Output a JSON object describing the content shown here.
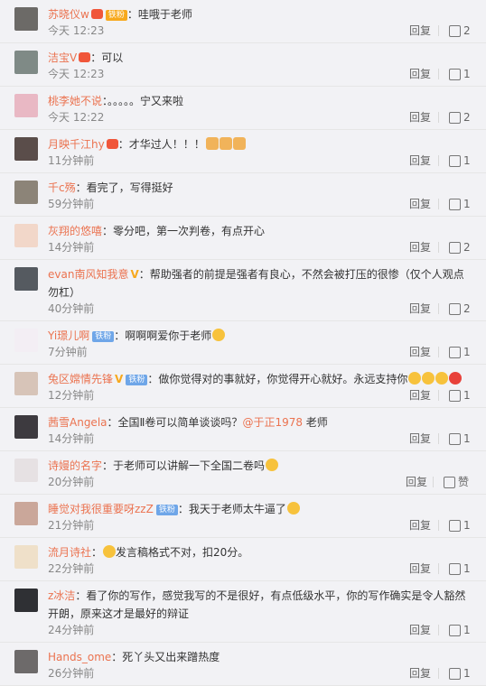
{
  "comments": [
    {
      "name": "苏晓仪w",
      "vip": true,
      "badge": "铁粉",
      "badge_color": "#f7a91e",
      "text": "：哇哦于老师",
      "time": "今天 12:23",
      "reply": "回复",
      "likes": "2",
      "avatar": "#6c6a67"
    },
    {
      "name": "洁宝V",
      "vip": true,
      "text": "：可以",
      "time": "今天 12:23",
      "reply": "回复",
      "likes": "1",
      "avatar": "#7f8a86"
    },
    {
      "name": "桃李她不说",
      "text": "：。。。。。宁又来啦",
      "time": "今天 12:22",
      "reply": "回复",
      "likes": "2",
      "avatar": "#e9b8c4"
    },
    {
      "name": "月映千江hy",
      "vip": true,
      "text": "：才华过人！！！",
      "emojis": [
        "thumb",
        "thumb",
        "thumb"
      ],
      "time": "11分钟前",
      "reply": "回复",
      "likes": "1",
      "avatar": "#5a4d4a"
    },
    {
      "name": "千c殇",
      "text": "：看完了，写得挺好",
      "time": "59分钟前",
      "reply": "回复",
      "likes": "1",
      "avatar": "#8c8478"
    },
    {
      "name": "灰翔的悠嘻",
      "text": "：零分吧，第一次判卷，有点开心",
      "time": "14分钟前",
      "reply": "回复",
      "likes": "2",
      "avatar": "#f2d7c9"
    },
    {
      "name": "evan南风知我意",
      "vgold": "V",
      "text": "：帮助强者的前提是强者有良心，不然会被打压的很惨（仅个人观点勿杠）",
      "time": "40分钟前",
      "reply": "回复",
      "likes": "2",
      "avatar": "#555a60",
      "tall": true
    },
    {
      "name": "Yi璟儿啊",
      "badge": "铁粉",
      "badge_color": "#6fa6e8",
      "text": "：啊啊啊爱你于老师",
      "emojis": [
        "face"
      ],
      "time": "7分钟前",
      "reply": "回复",
      "likes": "1",
      "avatar": "#f3eef4"
    },
    {
      "name": "兔区嫦情先锋",
      "vgold": "V",
      "badge": "铁粉",
      "badge_color": "#6fa6e8",
      "text": "：做你觉得对的事就好，你觉得开心就好。永远支持你",
      "emojis": [
        "face",
        "face",
        "face",
        "heart"
      ],
      "time": "12分钟前",
      "reply": "回复",
      "likes": "1",
      "avatar": "#d7c4b8"
    },
    {
      "name": "茜雪Angela",
      "text": "：全国Ⅱ卷可以简单谈谈吗？",
      "mention": "@于正1978",
      "after": " 老师",
      "time": "14分钟前",
      "reply": "回复",
      "likes": "1",
      "avatar": "#3d3a3f"
    },
    {
      "name": "诗嫚的名字",
      "text": "：于老师可以讲解一下全国二卷吗",
      "emojis": [
        "face"
      ],
      "time": "20分钟前",
      "reply": "回复",
      "likes": "赞",
      "avatar": "#e6e1e3"
    },
    {
      "name": "睡觉对我很重要呀zzZ",
      "badge": "铁粉",
      "badge_color": "#6fa6e8",
      "text": "：我天于老师太牛逼了",
      "emojis": [
        "face"
      ],
      "time": "21分钟前",
      "reply": "回复",
      "likes": "1",
      "avatar": "#caa79a"
    },
    {
      "name": "流月诗社",
      "text": "：",
      "emojis_before": [
        "face"
      ],
      "after": "发言稿格式不对，扣20分。",
      "time": "22分钟前",
      "reply": "回复",
      "likes": "1",
      "avatar": "#efe0c9"
    },
    {
      "name": "z冰洁",
      "text": "：看了你的写作，感觉我写的不是很好，有点低级水平，你的写作确实是令人豁然开朗，原来这才是最好的辩证",
      "time": "24分钟前",
      "reply": "回复",
      "likes": "1",
      "avatar": "#2f3034",
      "tall": true
    },
    {
      "name": "Hands_ome",
      "text": "：死丫头又出来蹭热度",
      "time": "26分钟前",
      "reply": "回复",
      "likes": "1",
      "avatar": "#6d6a6a"
    }
  ]
}
